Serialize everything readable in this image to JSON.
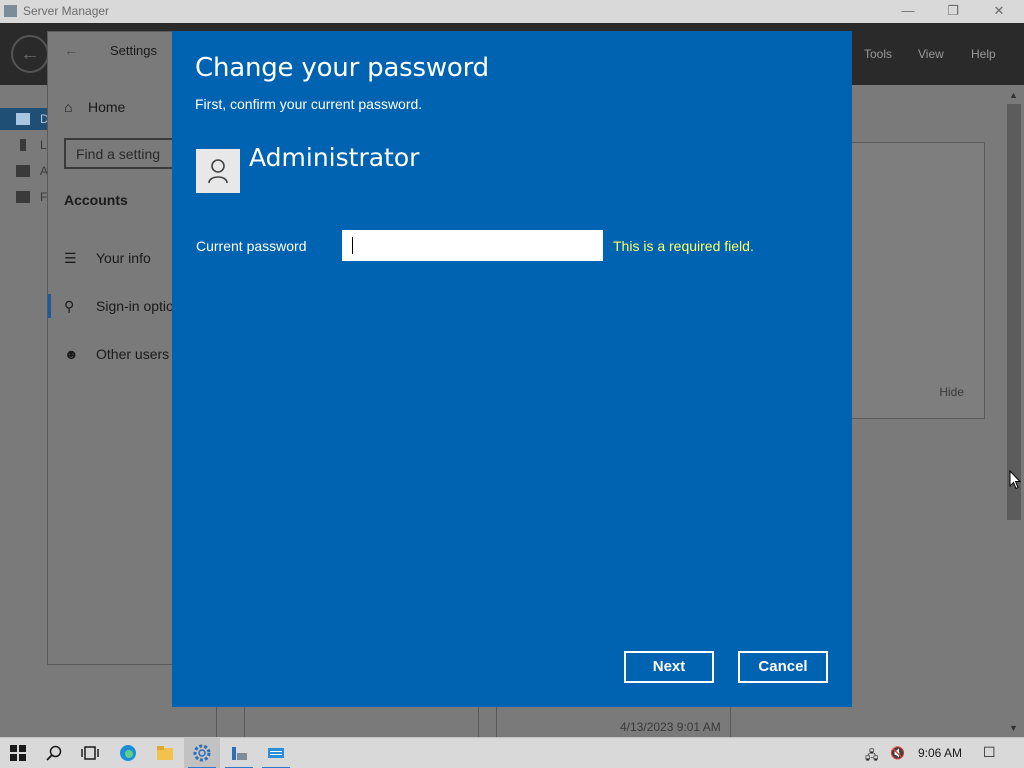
{
  "server_manager": {
    "title": "Server Manager",
    "menu": [
      "Tools",
      "View",
      "Help"
    ],
    "left_nav": [
      "D",
      "L",
      "A",
      "F"
    ],
    "tile_hide": "Hide",
    "bottom_date": "4/13/2023 9:01 AM"
  },
  "settings": {
    "title": "Settings",
    "home": "Home",
    "search_placeholder": "Find a setting",
    "section": "Accounts",
    "items": [
      {
        "label": "Your info",
        "icon": "person-list-icon"
      },
      {
        "label": "Sign-in optio",
        "icon": "key-icon"
      },
      {
        "label": "Other users",
        "icon": "person-add-icon"
      }
    ]
  },
  "dialog": {
    "heading": "Change your password",
    "subheading": "First, confirm your current password.",
    "username": "Administrator",
    "password_label": "Current password",
    "password_value": "",
    "error": "This is a required field.",
    "next_label": "Next",
    "cancel_label": "Cancel"
  },
  "taskbar": {
    "time": "9:06 AM",
    "accent": "#2a7ad0"
  },
  "colors": {
    "dialog_bg": "#0063b1",
    "error_text": "#ffff66"
  }
}
